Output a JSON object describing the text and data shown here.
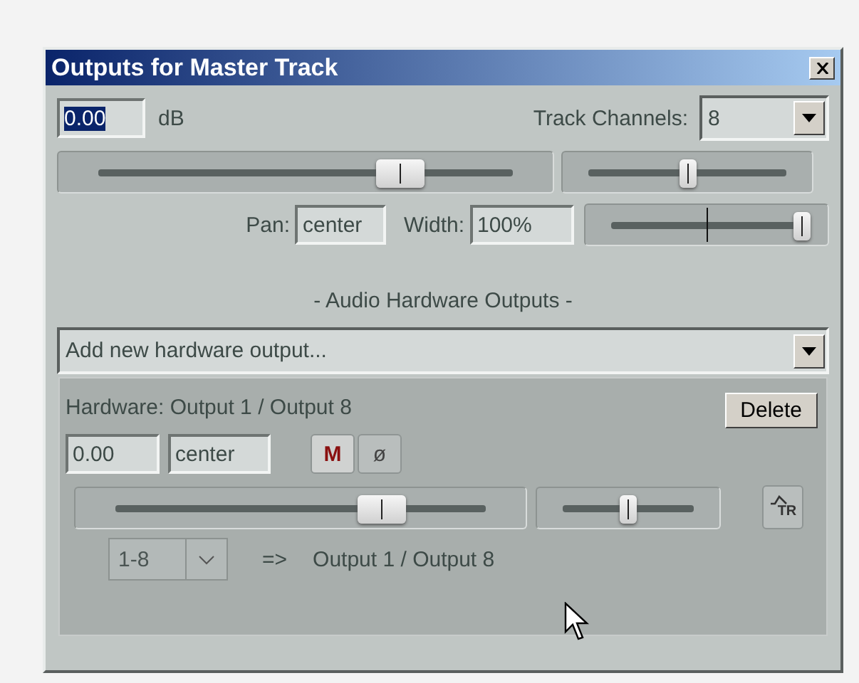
{
  "window": {
    "title": "Outputs for Master Track"
  },
  "volume": {
    "value": "0.00",
    "selected": true,
    "unit": "dB",
    "level": 0.73
  },
  "track_channels": {
    "label": "Track Channels:",
    "value": "8"
  },
  "pan_slider": {
    "level": 0.5
  },
  "pan": {
    "label": "Pan:",
    "value": "center"
  },
  "width": {
    "label": "Width:",
    "value": "100%",
    "level": 1.0
  },
  "section_title": "-  Audio Hardware Outputs  -",
  "add_output": {
    "value": "Add new hardware output..."
  },
  "hardware_outputs": [
    {
      "title": "Hardware: Output 1 / Output 8",
      "delete": "Delete",
      "volume": "0.00",
      "pan": "center",
      "mute": "M",
      "phase": "ø",
      "volume_slider": {
        "level": 0.72
      },
      "pan_slider": {
        "level": 0.5
      },
      "automation": "TR",
      "channels": "1-8",
      "arrow": "=>",
      "destination": "Output 1 / Output 8"
    }
  ]
}
